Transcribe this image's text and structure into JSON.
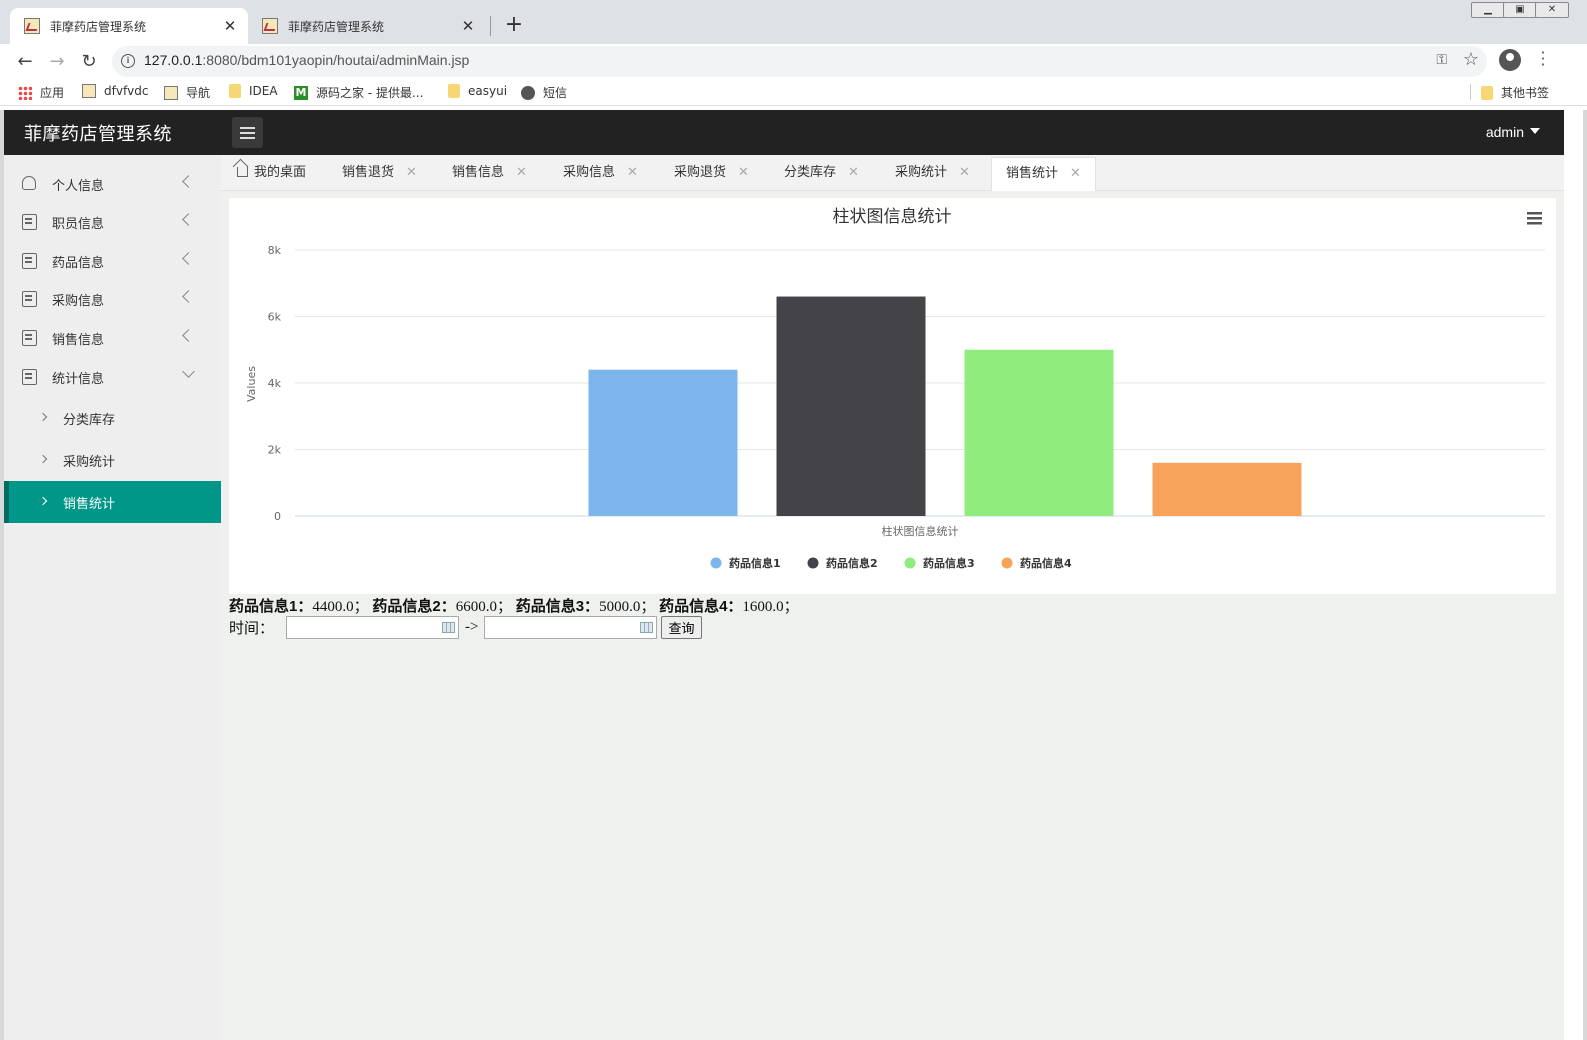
{
  "browser": {
    "tabs": [
      {
        "title": "菲摩药店管理系统",
        "active": true
      },
      {
        "title": "菲摩药店管理系统",
        "active": false
      }
    ],
    "url_host": "127.0.0.1",
    "url_rest": ":8080/bdm101yaopin/houtai/adminMain.jsp",
    "bookmarks": [
      "应用",
      "dfvfvdc",
      "导航",
      "IDEA",
      "源码之家 - 提供最...",
      "easyui",
      "短信"
    ],
    "other_bookmarks": "其他书签"
  },
  "app": {
    "brand": "菲摩药店管理系统",
    "user": "admin"
  },
  "sidebar": {
    "items": [
      {
        "label": "个人信息",
        "icon": "user-icon"
      },
      {
        "label": "职员信息",
        "icon": "document-icon"
      },
      {
        "label": "药品信息",
        "icon": "document-icon"
      },
      {
        "label": "采购信息",
        "icon": "document-icon"
      },
      {
        "label": "销售信息",
        "icon": "document-icon"
      },
      {
        "label": "统计信息",
        "icon": "document-icon",
        "expanded": true
      }
    ],
    "subitems": [
      {
        "label": "分类库存",
        "active": false
      },
      {
        "label": "采购统计",
        "active": false
      },
      {
        "label": "销售统计",
        "active": true
      }
    ],
    "active_color": "#009688"
  },
  "page_tabs": [
    {
      "label": "我的桌面",
      "closable": false
    },
    {
      "label": "销售退货",
      "closable": true
    },
    {
      "label": "销售信息",
      "closable": true
    },
    {
      "label": "采购信息",
      "closable": true
    },
    {
      "label": "采购退货",
      "closable": true
    },
    {
      "label": "分类库存",
      "closable": true
    },
    {
      "label": "采购统计",
      "closable": true
    },
    {
      "label": "销售统计",
      "closable": true,
      "active": true
    }
  ],
  "chart_data": {
    "type": "bar",
    "title": "柱状图信息统计",
    "xlabel": "柱状图信息统计",
    "ylabel": "Values",
    "ylim": [
      0,
      8000
    ],
    "yticks": [
      "0",
      "2k",
      "4k",
      "6k",
      "8k"
    ],
    "grid": true,
    "legend_position": "bottom",
    "series": [
      {
        "name": "药品信息1",
        "value": 4400,
        "color": "#7cb5ec"
      },
      {
        "name": "药品信息2",
        "value": 6600,
        "color": "#434348"
      },
      {
        "name": "药品信息3",
        "value": 5000,
        "color": "#90ed7d"
      },
      {
        "name": "药品信息4",
        "value": 1600,
        "color": "#f7a35c"
      }
    ]
  },
  "summary": [
    {
      "label": "药品信息1：",
      "value": "4400.0；"
    },
    {
      "label": "药品信息2：",
      "value": "6600.0；"
    },
    {
      "label": "药品信息3：",
      "value": "5000.0；"
    },
    {
      "label": "药品信息4：",
      "value": "1600.0；"
    }
  ],
  "query": {
    "time_label": "时间：",
    "arrow": "->",
    "button": "查询",
    "start_value": "",
    "end_value": ""
  }
}
